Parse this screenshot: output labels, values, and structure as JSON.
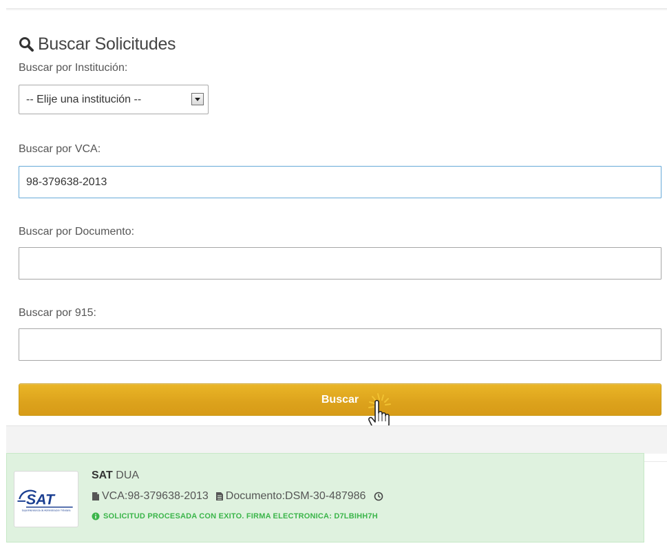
{
  "search_panel": {
    "title": "Buscar Solicitudes",
    "institution_label": "Buscar por Institución:",
    "institution_selected": "-- Elije una institución --",
    "vca_label": "Buscar por VCA:",
    "vca_value": "98-379638-2013",
    "document_label": "Buscar por Documento:",
    "document_value": "",
    "f915_label": "Buscar por 915:",
    "f915_value": "",
    "search_button": "Buscar"
  },
  "result": {
    "logo_text": "SAT",
    "logo_subtext": "Superintendencia de Administración Tributaria",
    "institution": "SAT",
    "type": "DUA",
    "vca": "VCA:98-379638-2013",
    "document": "Documento:DSM-30-487986",
    "status": "SOLICITUD PROCESADA CON EXITO. FIRMA ELECTRONICA: D7LBIHH7H"
  },
  "icons": {
    "title": "search-icon",
    "select_arrow": "chevron-down-icon",
    "vca": "file-icon",
    "document": "document-icon",
    "time": "clock-icon",
    "status": "info-circle-icon",
    "cursor": "hand-pointer-icon"
  },
  "colors": {
    "button": "#dca21c",
    "success_bg": "#dff2df",
    "success_text": "#3bb54a",
    "focus_border": "#66a9d8",
    "logo_blue": "#1b3f91"
  }
}
